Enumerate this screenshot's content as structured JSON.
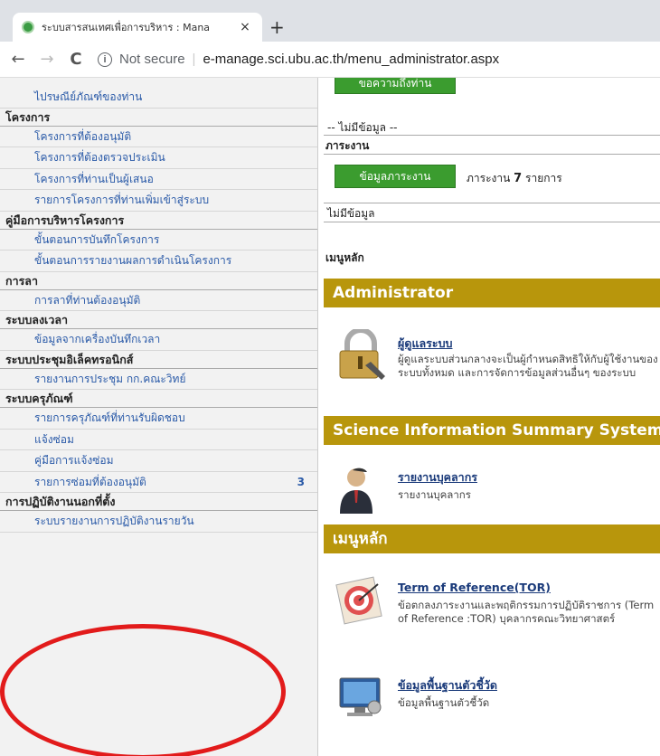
{
  "browser": {
    "tab_title": "ระบบสารสนเทศเพื่อการบริหาร : Mana",
    "tab_close": "×",
    "new_tab": "+",
    "back": "←",
    "forward": "→",
    "reload": "C",
    "security_icon_text": "i",
    "security_label": "Not secure",
    "separator": "|",
    "url": "e-manage.sci.ubu.ac.th/menu_administrator.aspx"
  },
  "sidebar": {
    "items": [
      {
        "type": "link",
        "label": "ไปรษณีย์ภัณฑ์ของท่าน"
      },
      {
        "type": "head",
        "label": "โครงการ"
      },
      {
        "type": "link",
        "label": "โครงการที่ต้องอนุมัติ"
      },
      {
        "type": "link",
        "label": "โครงการที่ต้องตรวจประเมิน"
      },
      {
        "type": "link",
        "label": "โครงการที่ท่านเป็นผู้เสนอ"
      },
      {
        "type": "link",
        "label": "รายการโครงการที่ท่านเพิ่มเข้าสู่ระบบ"
      },
      {
        "type": "head",
        "label": "คู่มือการบริหารโครงการ"
      },
      {
        "type": "link",
        "label": "ขั้นตอนการบันทึกโครงการ"
      },
      {
        "type": "link",
        "label": "ขั้นตอนการรายงานผลการดำเนินโครงการ"
      },
      {
        "type": "head",
        "label": "การลา"
      },
      {
        "type": "link",
        "label": "การลาที่ท่านต้องอนุมัติ"
      },
      {
        "type": "head",
        "label": "ระบบลงเวลา"
      },
      {
        "type": "link",
        "label": "ข้อมูลจากเครื่องบันทึกเวลา"
      },
      {
        "type": "head",
        "label": "ระบบประชุมอิเล็คทรอนิกส์"
      },
      {
        "type": "link",
        "label": "รายงานการประชุม กก.คณะวิทย์"
      },
      {
        "type": "head",
        "label": "ระบบครุภัณฑ์"
      },
      {
        "type": "link",
        "label": "รายการครุภัณฑ์ที่ท่านรับผิดชอบ"
      },
      {
        "type": "link",
        "label": "แจ้งซ่อม"
      },
      {
        "type": "link",
        "label": "คู่มือการแจ้งซ่อม"
      },
      {
        "type": "link",
        "label": "รายการซ่อมที่ต้องอนุมัติ",
        "badge": "3"
      },
      {
        "type": "head",
        "label": "การปฏิบัติงานนอกที่ตั้ง"
      },
      {
        "type": "link",
        "label": "ระบบรายงานการปฏิบัติงานรายวัน"
      }
    ]
  },
  "main": {
    "top_button": "ขอความถึงท่าน",
    "no_data_1": "-- ไม่มีข้อมูล --",
    "workload_label": "ภาระงาน",
    "workload_button": "ข้อมูลภาระงาน",
    "workload_summary_prefix": "ภาระงาน",
    "workload_count": "7",
    "workload_summary_suffix": "รายการ",
    "no_data_2": "ไม่มีข้อมูล",
    "main_menu_label": "เมนูหลัก",
    "sections": [
      {
        "title": "Administrator"
      },
      {
        "title": "Science Information Summary System"
      },
      {
        "title": "เมนูหลัก"
      }
    ],
    "items": [
      {
        "title": "ผู้ดูแลระบบ",
        "desc": "ผู้ดูแลระบบส่วนกลางจะเป็นผู้กำหนดสิทธิให้กับผู้ใช้งานของระบบทั้งหมด และการจัดการข้อมูลส่วนอื่นๆ ของระบบ",
        "icon": "padlock-icon"
      },
      {
        "title": "รายงานบุคลากร",
        "desc": "รายงานบุคลากร",
        "icon": "person-icon"
      },
      {
        "title": "Term of Reference(TOR)",
        "desc": "ข้อตกลงภาระงานและพฤติกรรมการปฏิบัติราชการ (Term of Reference :TOR) บุคลากรคณะวิทยาศาสตร์",
        "icon": "target-icon"
      },
      {
        "title": "ข้อมูลพื้นฐานตัวชี้วัด",
        "desc": "ข้อมูลพื้นฐานตัวชี้วัด",
        "icon": "monitor-icon"
      }
    ]
  },
  "colors": {
    "gold": "#b8960c",
    "green": "#3b9c2f",
    "link": "#2a5aa8",
    "annotation_red": "#e21b1b"
  }
}
